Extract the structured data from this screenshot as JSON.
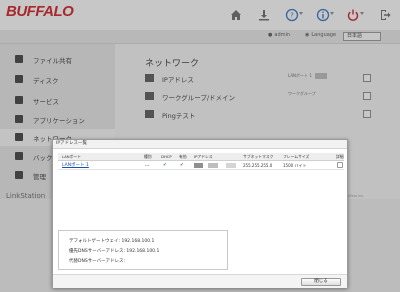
{
  "app": {
    "logo": "BUFFALO"
  },
  "header": {
    "icons": [
      "home-icon",
      "download-icon",
      "help-icon",
      "info-icon",
      "power-icon",
      "logout-icon"
    ]
  },
  "subbar": {
    "user": "admin",
    "language_label": "Language",
    "language_value": "日本語"
  },
  "sidebar": {
    "items": [
      {
        "label": "ファイル共有",
        "icon": "folder-icon"
      },
      {
        "label": "ディスク",
        "icon": "disk-icon"
      },
      {
        "label": "サービス",
        "icon": "services-icon"
      },
      {
        "label": "アプリケーション",
        "icon": "apps-icon"
      },
      {
        "label": "ネットワーク",
        "icon": "network-icon"
      },
      {
        "label": "バックアップ",
        "icon": "backup-icon"
      },
      {
        "label": "管理",
        "icon": "management-icon"
      }
    ]
  },
  "main": {
    "title": "ネットワーク",
    "rows": [
      {
        "label": "IPアドレス",
        "value": "LANポート 1",
        "icon": "ip-icon"
      },
      {
        "label": "ワークグループ/ドメイン",
        "value": "ワークグループ",
        "icon": "workgroup-icon"
      },
      {
        "label": "Pingテスト",
        "value": "",
        "icon": "ping-icon"
      }
    ]
  },
  "footer": {
    "brand": "LinkStation",
    "copyright": "© 2016 Buffalo Inc."
  },
  "dialog": {
    "title": "IPアドレス一覧",
    "columns": [
      "LANポート",
      "種別",
      "DHCP",
      "有効",
      "IPアドレス",
      "サブネットマスク",
      "フレームサイズ",
      "詳細"
    ],
    "rows": [
      {
        "port": "LANポート 1",
        "type": "---",
        "dhcp": "✔",
        "enabled": "✔",
        "subnet": "255.255.255.0",
        "frame": "1500 バイト"
      }
    ],
    "gateway_label": "デフォルトゲートウェイ:",
    "gateway_value": "192.168.100.1",
    "dns1_label": "優先DNSサーバーアドレス:",
    "dns1_value": "192.168.100.1",
    "dns2_label": "代替DNSサーバーアドレス:",
    "dns2_value": "",
    "close_label": "閉じる"
  },
  "colors": {
    "brand_red": "#d0151c",
    "link_blue": "#1a4fb0",
    "check_green": "#2a8a2a"
  }
}
